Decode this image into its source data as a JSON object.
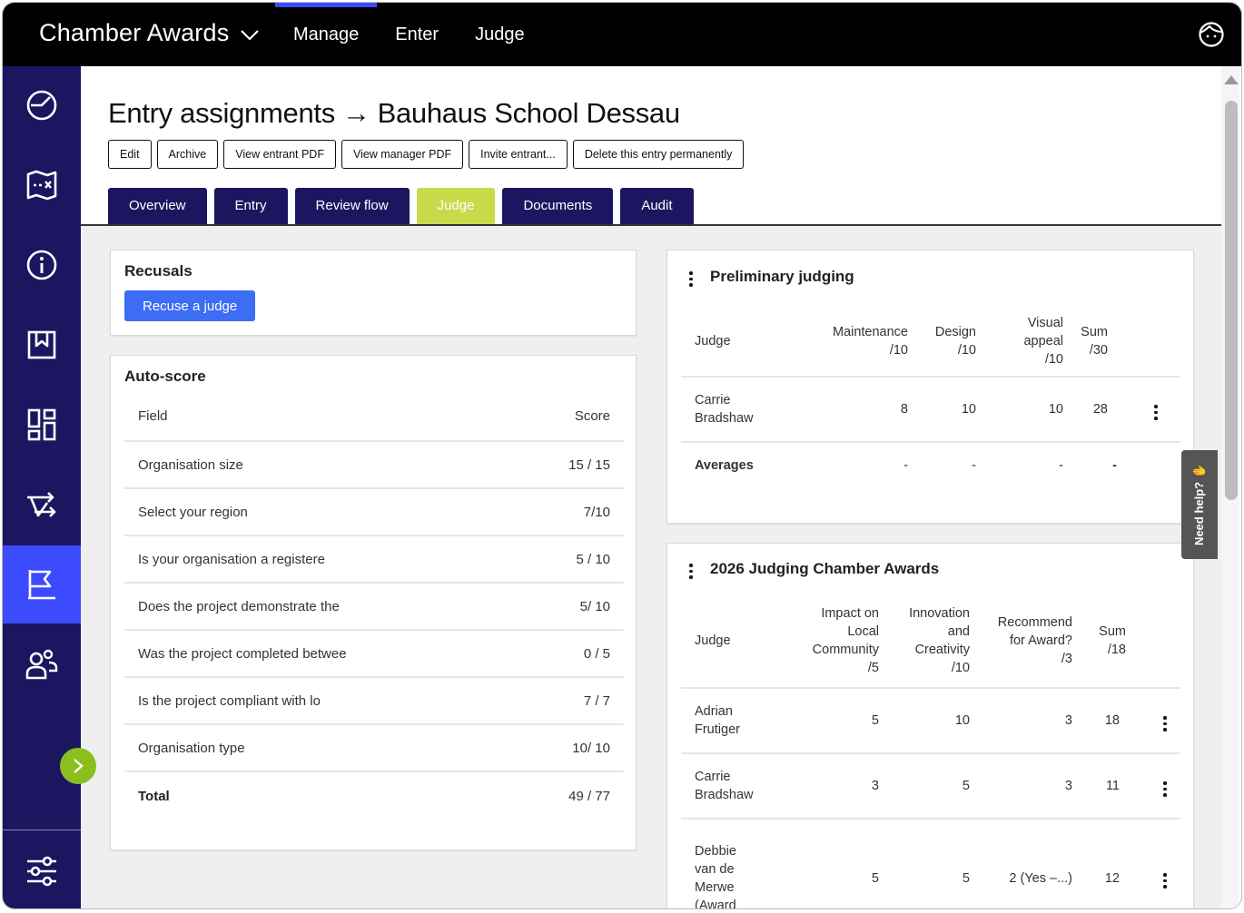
{
  "app": {
    "title": "Chamber Awards"
  },
  "topnav": [
    {
      "label": "Manage",
      "active": true
    },
    {
      "label": "Enter"
    },
    {
      "label": "Judge"
    }
  ],
  "page": {
    "title": "Entry assignments",
    "arrow": "→",
    "entry_name": "Bauhaus School Dessau"
  },
  "actions": [
    "Edit",
    "Archive",
    "View entrant PDF",
    "View manager PDF",
    "Invite entrant...",
    "Delete this entry permanently"
  ],
  "tabs": [
    "Overview",
    "Entry",
    "Review flow",
    "Judge",
    "Documents",
    "Audit"
  ],
  "active_tab": "Judge",
  "recusals": {
    "title": "Recusals",
    "button": "Recuse a judge"
  },
  "autoscore": {
    "title": "Auto-score",
    "headers": {
      "field": "Field",
      "score": "Score"
    },
    "rows": [
      {
        "field": "Organisation size",
        "score": "15 / 15"
      },
      {
        "field": "Select your region",
        "score": "7/10"
      },
      {
        "field": "Is your organisation a registere",
        "score": "5 / 10"
      },
      {
        "field": "Does the project demonstrate the",
        "score": "5/ 10"
      },
      {
        "field": "Was the project completed betwee",
        "score": "0 / 5"
      },
      {
        "field": "Is the project compliant with lo",
        "score": "7 / 7"
      },
      {
        "field": "Organisation type",
        "score": "10/ 10"
      }
    ],
    "total": {
      "label": "Total",
      "score": "49 / 77"
    }
  },
  "preliminary": {
    "title": "Preliminary judging",
    "headers": {
      "judge": "Judge",
      "c1": "Maintenance /10",
      "c2": "Design /10",
      "c3a": "Visual",
      "c3b": "appeal",
      "c3c": "/10",
      "sum_a": "Sum",
      "sum_b": "/30",
      "c1a": "Maintenance",
      "c1b": "/10",
      "c2a": "Design",
      "c2b": "/10"
    },
    "rows": [
      {
        "judge_a": "Carrie",
        "judge_b": "Bradshaw",
        "c1": "8",
        "c2": "10",
        "c3": "10",
        "sum": "28"
      }
    ],
    "averages": {
      "label": "Averages",
      "c1": "-",
      "c2": "-",
      "c3": "-",
      "sum": "-"
    }
  },
  "judging2026": {
    "title": "2026 Judging Chamber Awards",
    "headers": {
      "judge": "Judge",
      "c1": [
        "Impact on",
        "Local",
        "Community",
        "/5"
      ],
      "c2": [
        "Innovation",
        "and",
        "Creativity",
        "/10"
      ],
      "c3": [
        "Recommend",
        "for Award?",
        "/3"
      ],
      "sum": [
        "Sum",
        "/18"
      ]
    },
    "rows": [
      {
        "judge": [
          "Adrian",
          "Frutiger"
        ],
        "c1": "5",
        "c2": "10",
        "c3": "3",
        "sum": "18"
      },
      {
        "judge": [
          "Carrie",
          "Bradshaw"
        ],
        "c1": "3",
        "c2": "5",
        "c3": "3",
        "sum": "11"
      },
      {
        "judge": [
          "Debbie",
          "van de",
          "Merwe",
          "(Award"
        ],
        "c1": "5",
        "c2": "5",
        "c3": "2 (Yes –...)",
        "sum": "12"
      }
    ]
  },
  "help": {
    "label": "Need help?"
  },
  "colors": {
    "sidebar": "#1c1660",
    "accent": "#3d4bff",
    "active_tab": "#c9d94a",
    "button": "#3d6cf5",
    "expand": "#8bbf1e"
  },
  "icons": [
    "dashboard-icon",
    "map-icon",
    "info-icon",
    "bookmark-icon",
    "layout-icon",
    "workflow-icon",
    "flag-icon",
    "users-icon",
    "settings-sliders-icon",
    "user-avatar-icon",
    "chevron-down-icon",
    "chevron-right-icon",
    "hand-wave-icon"
  ]
}
